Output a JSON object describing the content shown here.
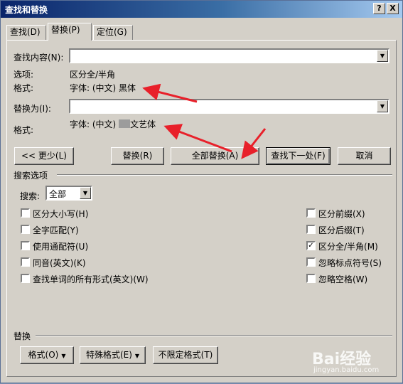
{
  "window": {
    "title": "查找和替换",
    "help_label": "?",
    "close_label": "X"
  },
  "tabs": [
    {
      "label": "查找(D)"
    },
    {
      "label": "替换(P)"
    },
    {
      "label": "定位(G)"
    }
  ],
  "find": {
    "label": "查找内容(N):",
    "value": "",
    "options_label": "选项:",
    "options_value": "区分全/半角",
    "format_label": "格式:",
    "format_value": "字体: (中文) 黑体"
  },
  "replace": {
    "label": "替换为(I):",
    "value": "",
    "format_label": "格式:",
    "format_prefix": "字体: (中文)",
    "format_suffix": "文艺体"
  },
  "buttons": {
    "less": "<< 更少(L)",
    "replace": "替换(R)",
    "replace_all": "全部替换(A)",
    "find_next": "查找下一处(F)",
    "cancel": "取消"
  },
  "search_options": {
    "title": "搜索选项",
    "search_label": "搜索:",
    "search_value": "全部",
    "left": [
      {
        "label": "区分大小写(H)",
        "checked": false
      },
      {
        "label": "全字匹配(Y)",
        "checked": false
      },
      {
        "label": "使用通配符(U)",
        "checked": false
      },
      {
        "label": "同音(英文)(K)",
        "checked": false
      },
      {
        "label": "查找单词的所有形式(英文)(W)",
        "checked": false
      }
    ],
    "right": [
      {
        "label": "区分前缀(X)",
        "checked": false
      },
      {
        "label": "区分后缀(T)",
        "checked": false
      },
      {
        "label": "区分全/半角(M)",
        "checked": true
      },
      {
        "label": "忽略标点符号(S)",
        "checked": false
      },
      {
        "label": "忽略空格(W)",
        "checked": false
      }
    ]
  },
  "replace_section": {
    "title": "替换",
    "format_button": "格式(O)",
    "special_button": "特殊格式(E)",
    "no_format_button": "不限定格式(T)"
  },
  "watermark": {
    "brand": "Bai经验",
    "url": "jingyan.baidu.com"
  },
  "colors": {
    "annotation_arrow": "#e8202a",
    "titlebar_start": "#0a246a",
    "dialog_bg": "#d4d0c8"
  }
}
